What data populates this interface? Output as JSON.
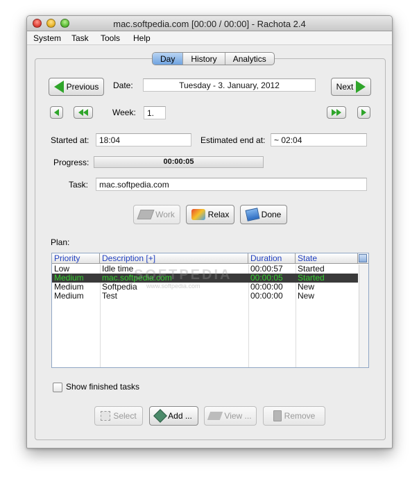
{
  "window": {
    "title": "mac.softpedia.com [00:00 / 00:00] - Rachota 2.4"
  },
  "menu": [
    "System",
    "Task",
    "Tools",
    "Help"
  ],
  "tabs": [
    "Day",
    "History",
    "Analytics"
  ],
  "active_tab": "Day",
  "day": {
    "previous_label": "Previous",
    "next_label": "Next",
    "date_label": "Date:",
    "date_value": "Tuesday - 3. January, 2012",
    "week_label": "Week:",
    "week_value": "1."
  },
  "task_info": {
    "started_label": "Started at:",
    "started_value": "18:04",
    "estimated_label": "Estimated end at:",
    "estimated_value": "~ 02:04",
    "progress_label": "Progress:",
    "progress_text": "00:00:05",
    "task_label": "Task:",
    "task_value": "mac.softpedia.com"
  },
  "actions": {
    "work": "Work",
    "relax": "Relax",
    "done": "Done"
  },
  "plan": {
    "label": "Plan:",
    "columns": [
      "Priority",
      "Description [+]",
      "Duration",
      "State"
    ],
    "rows": [
      {
        "priority": "Low",
        "description": "Idle time",
        "duration": "00:00:57",
        "state": "Started"
      },
      {
        "priority": "Medium",
        "description": "mac.softpedia.com",
        "duration": "00:00:05",
        "state": "Started"
      },
      {
        "priority": "Medium",
        "description": "Softpedia",
        "duration": "00:00:00",
        "state": "New"
      },
      {
        "priority": "Medium",
        "description": "Test",
        "duration": "00:00:00",
        "state": "New"
      }
    ],
    "selected_row": 1
  },
  "show_finished_label": "Show finished tasks",
  "bottom_buttons": {
    "select": "Select",
    "add": "Add ...",
    "view": "View ...",
    "remove": "Remove"
  },
  "watermark": {
    "text": "SOFTPEDIA",
    "sub": "www.softpedia.com"
  },
  "colors": {
    "arrow_green": "#2fa52a",
    "header_text": "#1f3fbf",
    "selected_bg": "#3a3a3a",
    "selected_text": "#34d12e"
  }
}
